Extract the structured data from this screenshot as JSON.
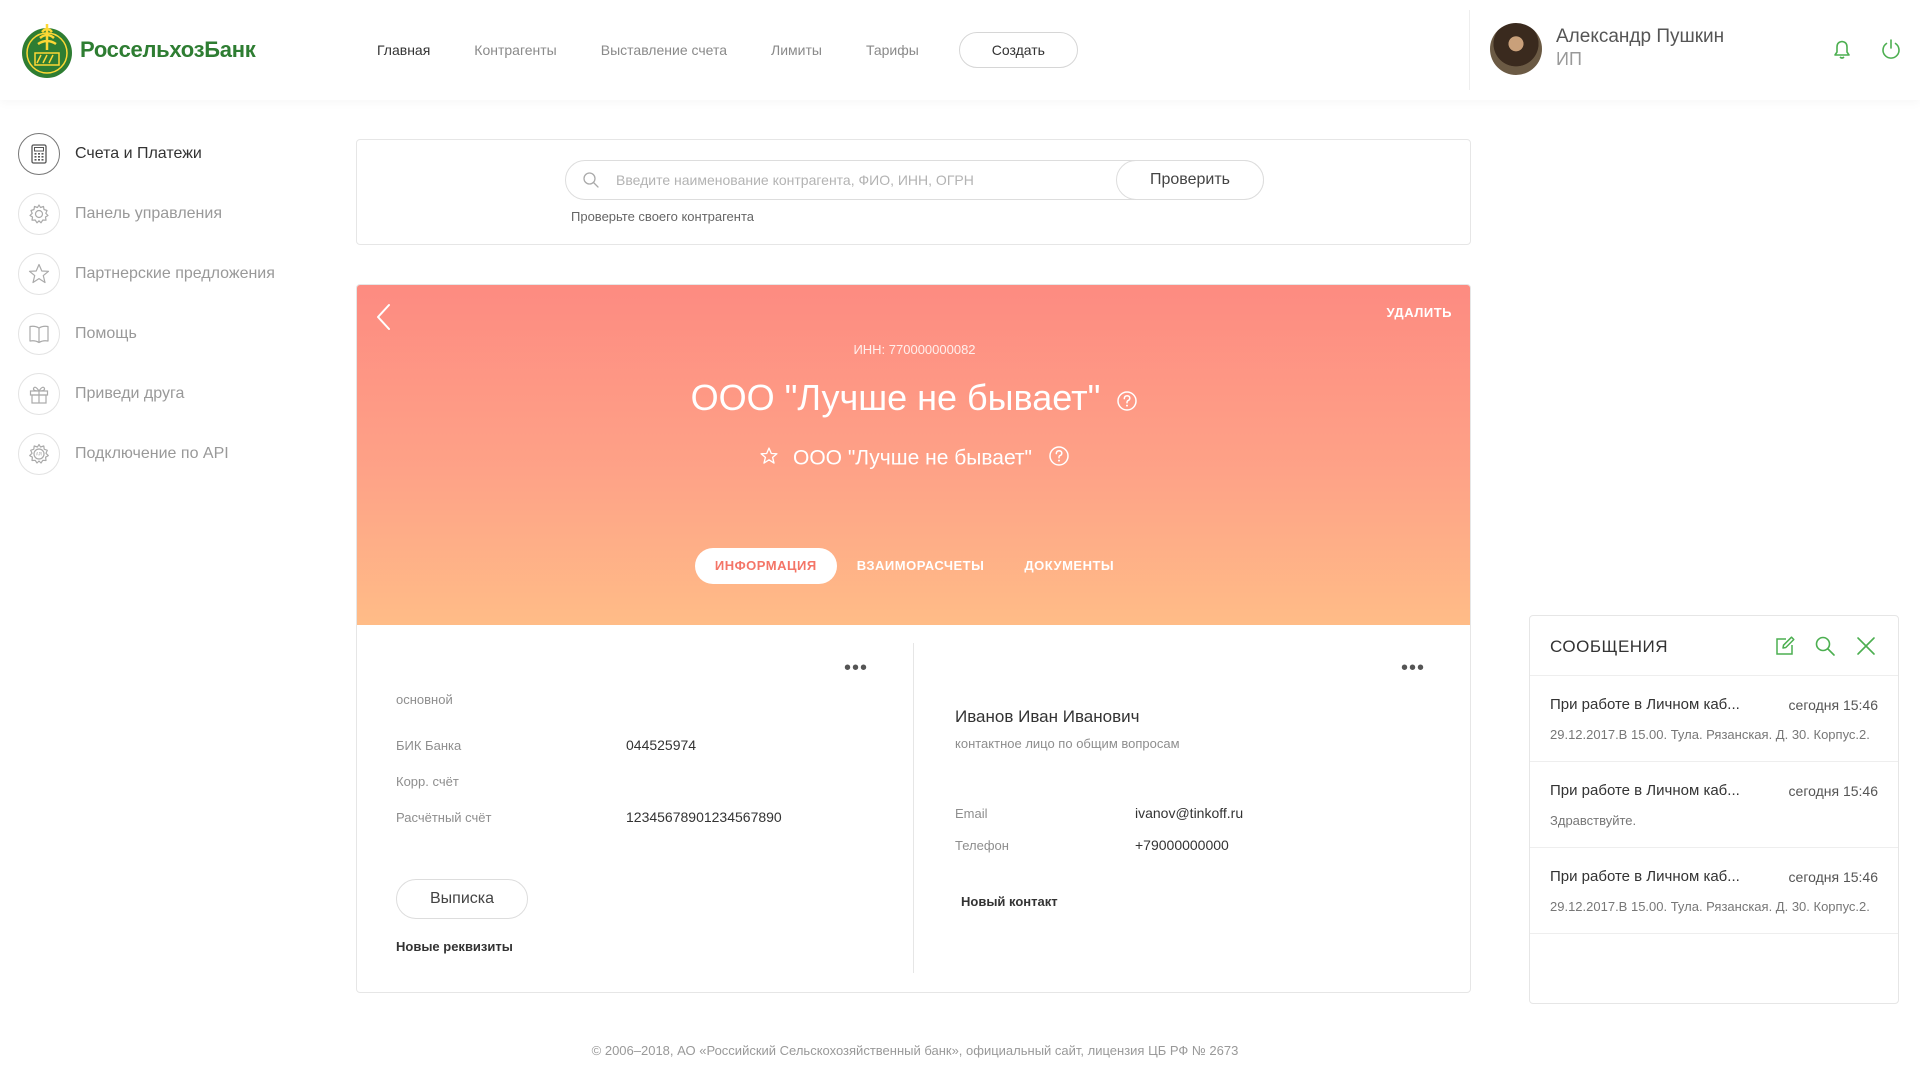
{
  "brand": {
    "name": "РоссельхозБанк",
    "accent": "#2e7d32",
    "icon_accent": "#4caf50"
  },
  "nav": {
    "items": [
      {
        "label": "Главная",
        "active": true
      },
      {
        "label": "Контрагенты"
      },
      {
        "label": "Выставление счета"
      },
      {
        "label": "Лимиты"
      },
      {
        "label": "Тарифы"
      }
    ],
    "create_label": "Создать"
  },
  "user": {
    "name": "Александр Пушкин",
    "role": "ИП"
  },
  "sidebar": {
    "items": [
      {
        "label": "Счета и Платежи",
        "icon": "calculator-icon",
        "active": true
      },
      {
        "label": "Панель управления",
        "icon": "gear-icon"
      },
      {
        "label": "Партнерские предложения",
        "icon": "star-icon"
      },
      {
        "label": "Помощь",
        "icon": "book-icon"
      },
      {
        "label": "Приведи друга",
        "icon": "gift-icon"
      },
      {
        "label": "Подключение по API",
        "icon": "api-gear-icon"
      }
    ]
  },
  "search": {
    "placeholder": "Введите наименование контрагента, ФИО, ИНН, ОГРН",
    "button_label": "Проверить",
    "hint": "Проверьте своего контрагента"
  },
  "company": {
    "delete_label": "УДАЛИТЬ",
    "inn": "ИНН: 770000000082",
    "title": "ООО \"Лучше не бывает\"",
    "subtitle": "ООО \"Лучше не бывает\"",
    "tabs": [
      {
        "label": "ИНФОРМАЦИЯ",
        "active": true
      },
      {
        "label": "ВЗАИМОРАСЧЕТЫ"
      },
      {
        "label": "ДОКУМЕНТЫ"
      }
    ],
    "gradient": [
      "#fd8b81",
      "#ffbc87"
    ]
  },
  "account": {
    "type": "основной",
    "bik_label": "БИК Банка",
    "bik_value": "044525974",
    "corr_label": "Корр. счёт",
    "corr_value": "",
    "settlement_label": "Расчётный счёт",
    "settlement_value": "12345678901234567890",
    "statement_label": "Выписка",
    "new_details_label": "Новые реквизиты"
  },
  "contact": {
    "name": "Иванов Иван Иванович",
    "role": "контактное лицо по общим вопросам",
    "email_label": "Email",
    "email_value": "ivanov@tinkoff.ru",
    "phone_label": "Телефон",
    "phone_value": "+79000000000",
    "new_contact_label": "Новый контакт"
  },
  "messages": {
    "title": "СООБЩЕНИЯ",
    "items": [
      {
        "title": "При работе в Личном каб...",
        "time": "сегодня 15:46",
        "body": "29.12.2017.В 15.00. Тула. Рязанская. Д. 30. Корпус.2."
      },
      {
        "title": "При работе в Личном каб...",
        "time": "сегодня 15:46",
        "body": "Здравствуйте."
      },
      {
        "title": "При работе в Личном каб...",
        "time": "сегодня 15:46",
        "body": "29.12.2017.В 15.00. Тула. Рязанская. Д. 30. Корпус.2."
      }
    ]
  },
  "footer": {
    "text": "© 2006–2018, АО «Российский Сельскохозяйственный банк», официальный сайт, лицензия ЦБ РФ № 2673"
  }
}
